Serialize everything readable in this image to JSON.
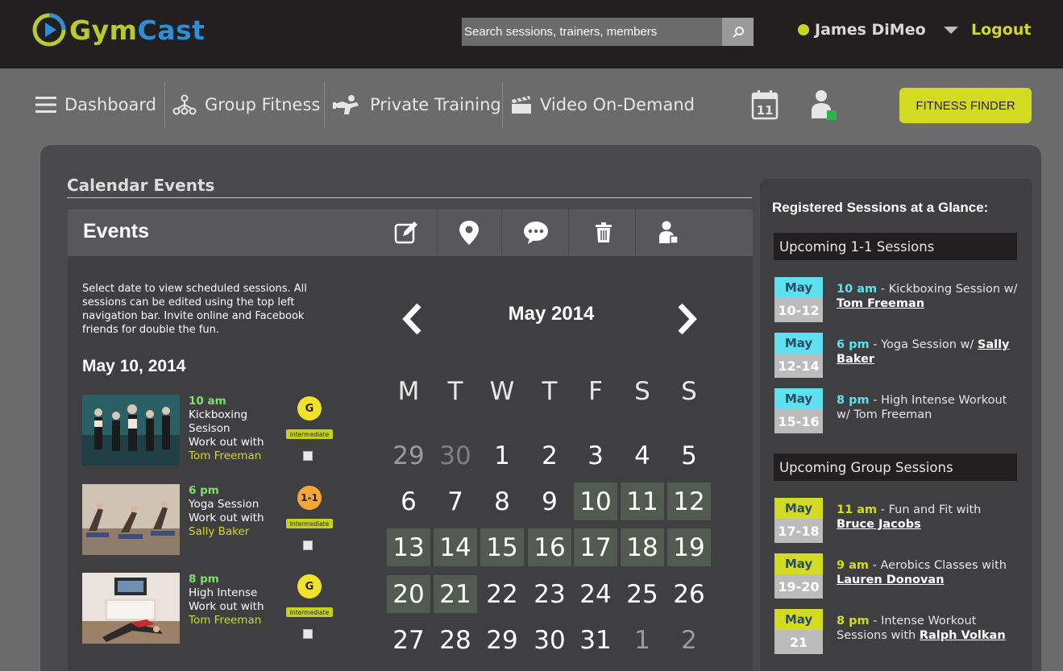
{
  "header": {
    "logo_g": "G",
    "logo_ym": "ym",
    "logo_cast": "Cast",
    "search_placeholder": "Search sessions, trainers, members",
    "user_name": "James DiMeo",
    "logout": "Logout"
  },
  "nav": {
    "dashboard": "Dashboard",
    "group_fitness": "Group Fitness",
    "private_training": "Private Training",
    "video_on_demand": "Video On-Demand",
    "calendar_day": "11",
    "fitness_finder": "FITNESS FINDER"
  },
  "colors": {
    "accent": "#d2da22",
    "time_green": "#7ee06a",
    "cyan_chip": "#5ee0f0",
    "header_bg": "#231f20"
  },
  "main": {
    "section_title": "Calendar Events",
    "events_title": "Events",
    "intro": "Select date to view scheduled sessions. All sessions can be edited using the top left navigation bar. Invite online and Facebook friends for double the fun.",
    "selected_date": "May 10, 2014",
    "sessions": [
      {
        "time": "10 am",
        "line1": "Kickboxing",
        "line2": "Sesison",
        "line3": "Work out with",
        "trainer": "Tom Freeman",
        "badge": "G",
        "level": "Intermediate"
      },
      {
        "time": "6 pm",
        "line1": "Yoga Session",
        "line2": "",
        "line3": "Work out with",
        "trainer": "Sally Baker",
        "badge": "1-1",
        "level": "Intermediate"
      },
      {
        "time": "8 pm",
        "line1": "High Intense",
        "line2": "",
        "line3": "Work out with",
        "trainer": "Tom Freeman",
        "badge": "G",
        "level": "Intermediate"
      }
    ],
    "calendar": {
      "month": "May 2014",
      "weekdays": [
        "M",
        "T",
        "W",
        "T",
        "F",
        "S",
        "S"
      ],
      "weeks": [
        [
          "29",
          "30",
          "1",
          "2",
          "3",
          "4",
          "5"
        ],
        [
          "6",
          "7",
          "8",
          "9",
          "10",
          "11",
          "12"
        ],
        [
          "13",
          "14",
          "15",
          "16",
          "17",
          "18",
          "19"
        ],
        [
          "20",
          "21",
          "22",
          "23",
          "24",
          "25",
          "26"
        ],
        [
          "27",
          "28",
          "29",
          "30",
          "31",
          "1",
          "2"
        ]
      ]
    }
  },
  "sidebar": {
    "title": "Registered Sessions at a Glance:",
    "upcoming_1_1": "Upcoming 1-1 Sessions",
    "upcoming_group": "Upcoming Group Sessions",
    "one_on_one": [
      {
        "month": "May",
        "dates": "10-12",
        "time": "10 am",
        "desc": " - Kickboxing Session w/ ",
        "trainer": "Tom Freeman"
      },
      {
        "month": "May",
        "dates": "12-14",
        "time": "6 pm",
        "desc": " - Yoga Session w/ ",
        "trainer": "Sally Baker"
      },
      {
        "month": "May",
        "dates": "15-16",
        "time": "8 pm",
        "desc": " - High Intense Workout w/ Tom Freeman",
        "trainer": ""
      }
    ],
    "group": [
      {
        "month": "May",
        "dates": "17-18",
        "time": "11 am",
        "desc": " - Fun and Fit with ",
        "trainer": "Bruce Jacobs"
      },
      {
        "month": "May",
        "dates": "19-20",
        "time": "9 am",
        "desc": " - Aerobics Classes with ",
        "trainer": "Lauren Donovan"
      },
      {
        "month": "May",
        "dates": "21",
        "time": "8 pm",
        "desc": " - Intense Workout Sessions with ",
        "trainer": "Ralph Volkan"
      }
    ]
  }
}
